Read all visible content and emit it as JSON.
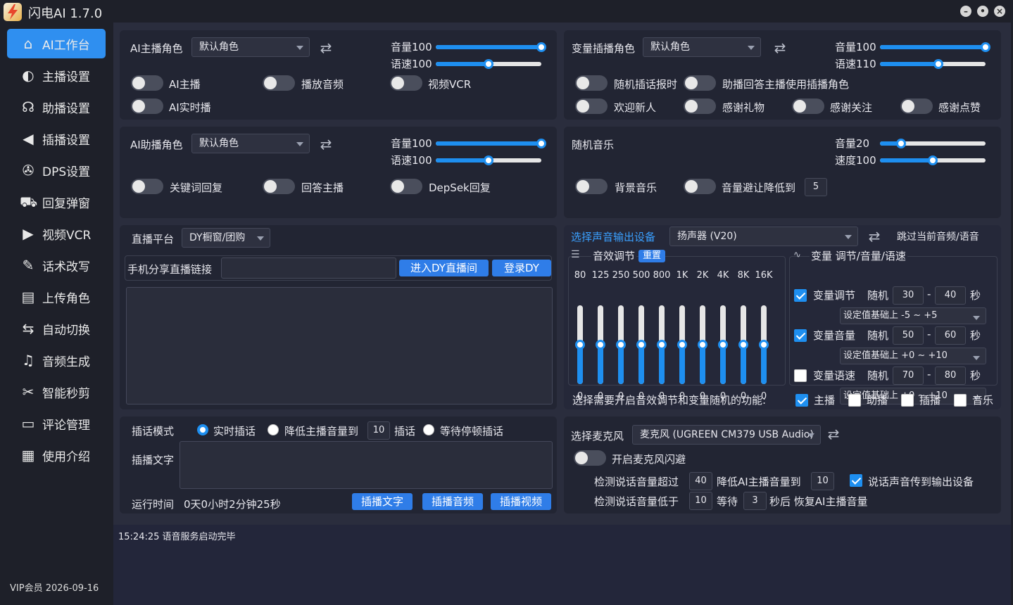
{
  "app": {
    "title": "闪电AI 1.7.0"
  },
  "sidebar": {
    "items": [
      {
        "label": "AI工作台",
        "icon": "home-icon"
      },
      {
        "label": "主播设置",
        "icon": "anchor-icon"
      },
      {
        "label": "助播设置",
        "icon": "headset-icon"
      },
      {
        "label": "插播设置",
        "icon": "speaker-icon"
      },
      {
        "label": "DPS设置",
        "icon": "tool-icon"
      },
      {
        "label": "回复弹窗",
        "icon": "cart-icon"
      },
      {
        "label": "视频VCR",
        "icon": "video-icon"
      },
      {
        "label": "话术改写",
        "icon": "magic-icon"
      },
      {
        "label": "上传角色",
        "icon": "upload-icon"
      },
      {
        "label": "自动切换",
        "icon": "switch-icon"
      },
      {
        "label": "音频生成",
        "icon": "audio-folder-icon"
      },
      {
        "label": "智能秒剪",
        "icon": "scissors-icon"
      },
      {
        "label": "评论管理",
        "icon": "comment-icon"
      },
      {
        "label": "使用介绍",
        "icon": "doc-icon"
      }
    ],
    "vip": "VIP会员  2026-09-16"
  },
  "anchor": {
    "role_label": "AI主播角色",
    "role_value": "默认角色",
    "vol_label": "音量100",
    "speed_label": "语速100",
    "vol": 100,
    "speed": 50,
    "toggles": [
      "AI主播",
      "播放音频",
      "视频VCR",
      "AI实时播"
    ]
  },
  "assistant": {
    "role_label": "AI助播角色",
    "role_value": "默认角色",
    "vol_label": "音量100",
    "speed_label": "语速100",
    "vol": 100,
    "speed": 50,
    "toggles": [
      "关键词回复",
      "回答主播",
      "DepSek回复"
    ]
  },
  "interject_role": {
    "role_label": "变量插播角色",
    "role_value": "默认角色",
    "vol_label": "音量100",
    "speed_label": "语速110",
    "vol": 100,
    "speed": 55,
    "toggles": [
      "随机插话报时",
      "助播回答主播使用插播角色",
      "欢迎新人",
      "感谢礼物",
      "感谢关注",
      "感谢点赞"
    ]
  },
  "music": {
    "title": "随机音乐",
    "vol_label": "音量20",
    "speed_label": "速度100",
    "vol": 20,
    "speed": 50,
    "toggles": [
      "背景音乐",
      "音量避让降低到"
    ],
    "duck_value": "5"
  },
  "platform": {
    "label": "直播平台",
    "value": "DY橱窗/团购",
    "link_label": "手机分享直播链接",
    "link_value": "",
    "enter_btn": "进入DY直播间",
    "login_btn": "登录DY"
  },
  "output": {
    "label": "选择声音输出设备",
    "device": "扬声器 (V20)",
    "skip": "跳过当前音频/语音",
    "eq_title": "音效调节",
    "eq_reset": "重置",
    "eq_bands": [
      "80",
      "125",
      "250",
      "500",
      "800",
      "1K",
      "2K",
      "4K",
      "8K",
      "16K"
    ],
    "eq_values": [
      "0",
      "0",
      "0",
      "0",
      "0",
      "0",
      "0",
      "0",
      "0",
      "0"
    ],
    "var_title": "变量 调节/音量/语速",
    "vars": [
      {
        "label": "变量调节",
        "checked": true,
        "rand": "随机",
        "min": "30",
        "max": "40",
        "unit": "秒",
        "mode": "设定值基础上 -5 ~ +5"
      },
      {
        "label": "变量音量",
        "checked": true,
        "rand": "随机",
        "min": "50",
        "max": "60",
        "unit": "秒",
        "mode": "设定值基础上 +0 ~ +10"
      },
      {
        "label": "变量语速",
        "checked": false,
        "rand": "随机",
        "min": "70",
        "max": "80",
        "unit": "秒",
        "mode": "设定值基础上 +0 ~ +10"
      }
    ],
    "dash": "-",
    "apply_label": "选择需要开启音效调节和变量随机的功能:",
    "apply": [
      {
        "label": "主播",
        "checked": true
      },
      {
        "label": "助播",
        "checked": false
      },
      {
        "label": "插播",
        "checked": false
      },
      {
        "label": "音乐",
        "checked": false
      }
    ]
  },
  "insert": {
    "mode_label": "插话模式",
    "opt1": "实时插话",
    "opt2a": "降低主播音量到",
    "opt2_value": "10",
    "opt2b": "插话",
    "opt3": "等待停顿插话",
    "text_label": "插播文字",
    "runtime_label": "运行时间",
    "runtime": "0天0小时2分钟25秒",
    "btn_text": "插播文字",
    "btn_audio": "插播音频",
    "btn_video": "插播视频"
  },
  "mic": {
    "label": "选择麦克风",
    "device": "麦克风 (UGREEN CM379 USB Audio)",
    "avoid": "开启麦克风闪避",
    "l1a": "检测说话音量超过",
    "l1v": "40",
    "l1b": "降低AI主播音量到",
    "l1v2": "10",
    "pass": "说话声音传到输出设备",
    "l2a": "检测说话音量低于",
    "l2v": "10",
    "l2b": "等待",
    "l2v2": "3",
    "l2c": "秒后 恢复AI主播音量"
  },
  "log": {
    "line": "15:24:25 语音服务启动完毕"
  },
  "colors": {
    "accent": "#1e8ff0",
    "panel": "#222533",
    "bg": "#2a2d3d"
  }
}
